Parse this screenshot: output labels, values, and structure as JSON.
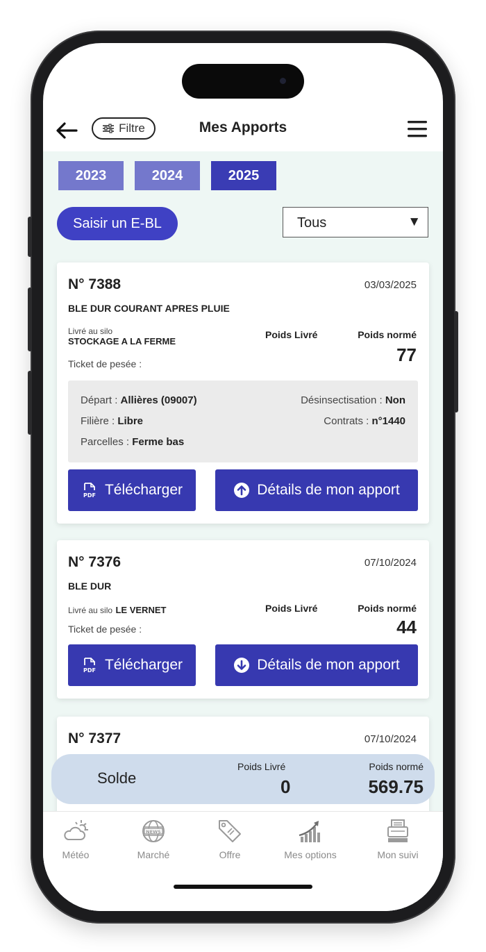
{
  "header": {
    "title": "Mes Apports",
    "filter_label": "Filtre"
  },
  "years": {
    "tabs": [
      "2023",
      "2024",
      "2025"
    ],
    "active": "2025"
  },
  "actions": {
    "ebl_label": "Saisir un E-BL",
    "select_value": "Tous"
  },
  "cards": [
    {
      "number": "N° 7388",
      "date": "03/03/2025",
      "product": "BLE DUR COURANT APRES PLUIE",
      "silo_prefix": "Livré au silo",
      "silo_name": "STOCKAGE A LA FERME",
      "ticket": "Ticket de pesée :",
      "poids_livre_label": "Poids Livré",
      "poids_norme_label": "Poids normé",
      "poids_norme": "77",
      "details": {
        "depart_label": "Départ : ",
        "depart": "Allières (09007)",
        "desinsect_label": "Désinsectisation : ",
        "desinsect": "Non",
        "filiere_label": "Filière : ",
        "filiere": "Libre",
        "contrats_label": "Contrats : ",
        "contrats": "n°1440",
        "parcelles_label": "Parcelles : ",
        "parcelles": "Ferme bas"
      },
      "download_label": "Télécharger",
      "details_label": "Détails de mon apport"
    },
    {
      "number": "N° 7376",
      "date": "07/10/2024",
      "product": "BLE DUR",
      "silo_prefix": "Livré au silo",
      "silo_name": "LE VERNET",
      "ticket": "Ticket de pesée :",
      "poids_livre_label": "Poids Livré",
      "poids_norme_label": "Poids normé",
      "poids_norme": "44",
      "download_label": "Télécharger",
      "details_label": "Détails de mon apport"
    },
    {
      "number": "N° 7377",
      "date": "07/10/2024"
    }
  ],
  "solde": {
    "label": "Solde",
    "poids_livre_label": "Poids Livré",
    "poids_livre": "0",
    "poids_norme_label": "Poids normé",
    "poids_norme": "569.75"
  },
  "nav": [
    {
      "label": "Météo",
      "icon": "weather-icon"
    },
    {
      "label": "Marché",
      "icon": "news-globe-icon"
    },
    {
      "label": "Offre",
      "icon": "price-tag-icon"
    },
    {
      "label": "Mes options",
      "icon": "chart-growth-icon"
    },
    {
      "label": "Mon suivi",
      "icon": "printer-icon"
    }
  ],
  "colors": {
    "primary": "#3739b0",
    "tab_inactive": "#7478cc",
    "background": "#eef7f4",
    "solde_bg": "#cfdcec"
  }
}
